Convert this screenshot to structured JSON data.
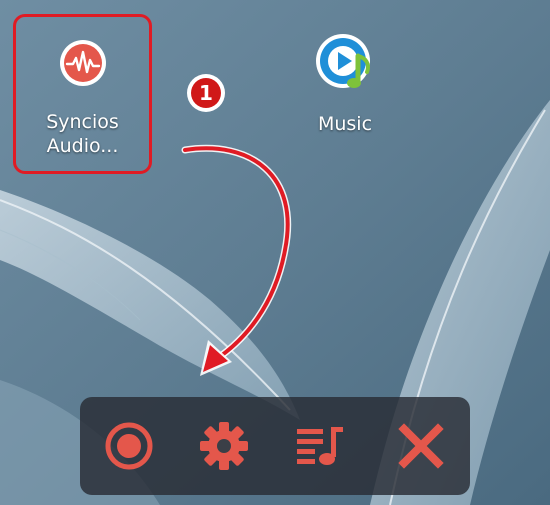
{
  "desktop": {
    "apps": [
      {
        "label": "Syncios Audio...",
        "label_line1": "Syncios",
        "label_line2": "Audio...",
        "icon": "syncios-audio-icon"
      },
      {
        "label": "Music",
        "icon": "music-icon"
      }
    ],
    "step_badge": "1"
  },
  "recorder_toolbar": {
    "buttons": [
      {
        "name": "record",
        "icon": "record-icon"
      },
      {
        "name": "settings",
        "icon": "gear-icon"
      },
      {
        "name": "playlist",
        "icon": "playlist-music-icon"
      },
      {
        "name": "close",
        "icon": "close-icon"
      }
    ]
  },
  "colors": {
    "accent_red": "#e4574b",
    "highlight_red": "#e01b24",
    "wallpaper_blue": "#5f7f94",
    "music_blue": "#1f8fd8",
    "music_green": "#7ec23a"
  }
}
